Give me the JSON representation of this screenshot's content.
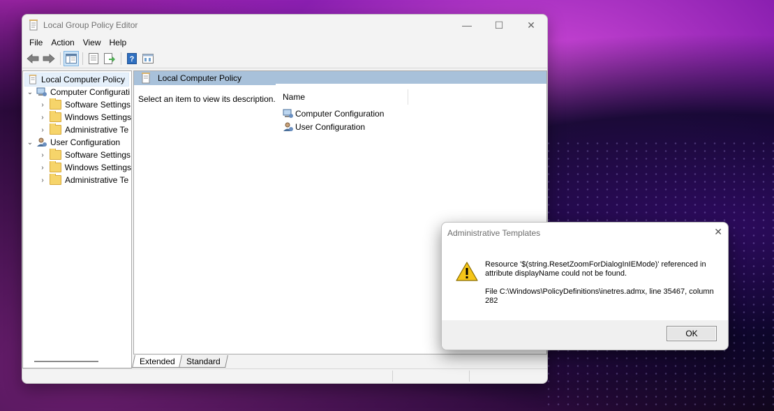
{
  "window": {
    "title": "Local Group Policy Editor",
    "controls": {
      "minimize": "—",
      "maximize": "☐",
      "close": "✕"
    }
  },
  "menu": [
    "File",
    "Action",
    "View",
    "Help"
  ],
  "toolbar": [
    "back-icon",
    "forward-icon",
    "show-hide-tree-icon",
    "properties-icon",
    "export-list-icon",
    "help-icon",
    "filter-icon"
  ],
  "tree": {
    "root": "Local Computer Policy",
    "computer": {
      "label": "Computer Configurati",
      "children": [
        "Software Settings",
        "Windows Settings",
        "Administrative Te"
      ]
    },
    "user": {
      "label": "User Configuration",
      "children": [
        "Software Settings",
        "Windows Settings",
        "Administrative Te"
      ]
    }
  },
  "right_pane": {
    "header": "Local Computer Policy",
    "description": "Select an item to view its description.",
    "column_name": "Name",
    "items": [
      "Computer Configuration",
      "User Configuration"
    ]
  },
  "tabs": [
    "Extended",
    "Standard"
  ],
  "dialog": {
    "title": "Administrative Templates",
    "close": "✕",
    "message_line1": "Resource '$(string.ResetZoomForDialogInIEMode)' referenced in attribute displayName could not be found.",
    "message_line2": "File C:\\Windows\\PolicyDefinitions\\inetres.admx, line 35467, column 282",
    "ok_label": "OK"
  }
}
